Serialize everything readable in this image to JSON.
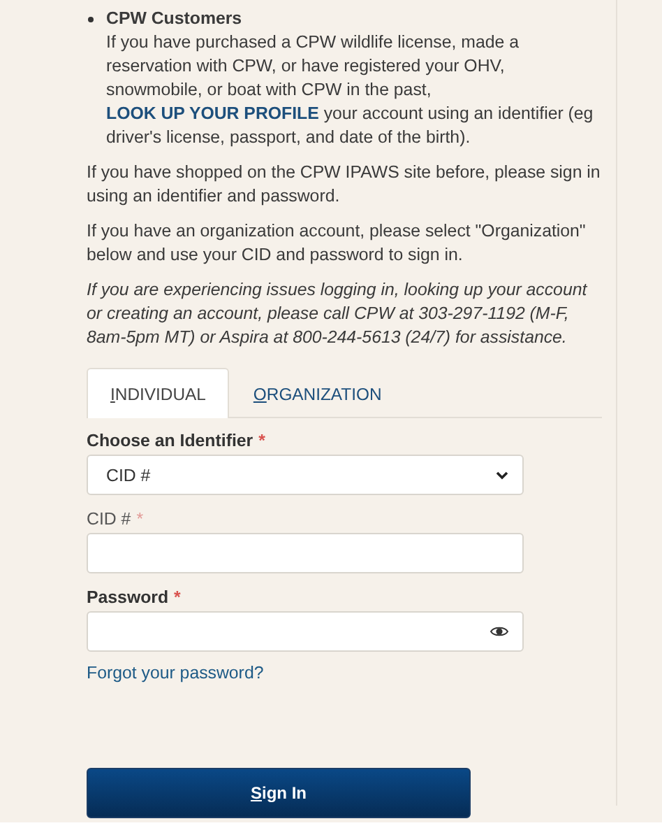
{
  "customer_note": {
    "heading": "CPW Customers",
    "text_before": "If you have purchased a CPW wildlife license, made a reservation with CPW, or have registered your OHV, snowmobile, or boat with CPW in the past,",
    "link": "LOOK UP YOUR PROFILE",
    "text_after": "your account using an identifier (eg driver's license, passport, and date of the birth)."
  },
  "paragraphs": [
    {
      "kind": "plain",
      "text": "If you have shopped on the CPW IPAWS site before, please sign in using an identifier and password."
    },
    {
      "kind": "plain",
      "text": "If you have an organization account, please select \"Organization\" below and use your CID and password to sign in."
    },
    {
      "kind": "note",
      "text": "If you are experiencing issues logging in, looking up your account or creating an account, please call CPW at 303-297-1192 (M-F, 8am-5pm MT) or Aspira at 800-244-5613 (24/7) for assistance."
    }
  ],
  "tabs": [
    {
      "label": "INDIVIDUAL",
      "selected": true
    },
    {
      "label": "ORGANIZATION",
      "selected": false
    }
  ],
  "fields": [
    {
      "kind": "select",
      "label": "Choose an Identifier",
      "bold": true,
      "required_mark": "*",
      "value": "CID #"
    },
    {
      "kind": "text",
      "label": "CID #",
      "bold": false,
      "required_mark": "*"
    },
    {
      "kind": "password",
      "label": "Password",
      "bold": true,
      "required_mark": "*"
    }
  ],
  "forgot_link": "Forgot your password?",
  "sign_in_button": "Sign In"
}
